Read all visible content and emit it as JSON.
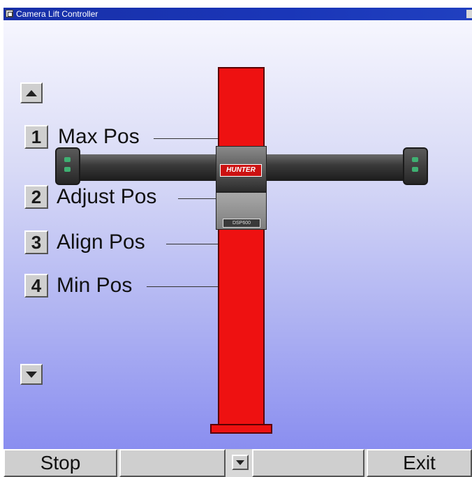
{
  "window": {
    "title": "Camera Lift Controller",
    "title_bar_color": "#1a36b8"
  },
  "controls": {
    "up_icon": "arrow-up-icon",
    "down_icon": "arrow-down-icon"
  },
  "positions": [
    {
      "number": "1",
      "label": "Max Pos"
    },
    {
      "number": "2",
      "label": "Adjust Pos"
    },
    {
      "number": "3",
      "label": "Align Pos"
    },
    {
      "number": "4",
      "label": "Min Pos"
    }
  ],
  "lift": {
    "brand": "HUNTER",
    "model_plate": "DSP600",
    "pole_color": "#ee1111"
  },
  "toolbar": {
    "stop_label": "Stop",
    "exit_label": "Exit",
    "dropdown_icon": "chevron-down-icon"
  }
}
